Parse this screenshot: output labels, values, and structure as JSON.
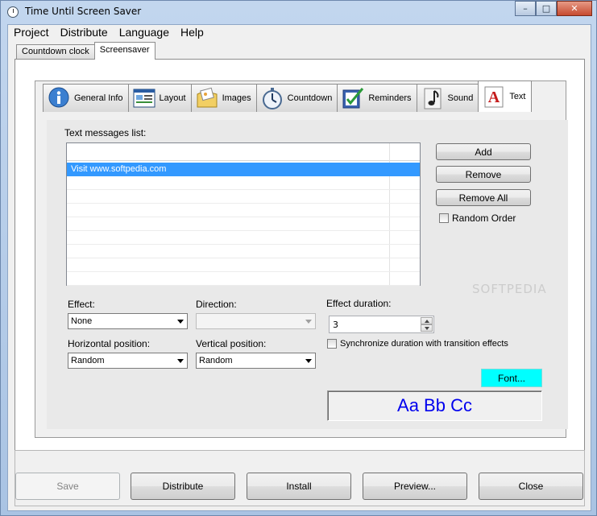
{
  "window": {
    "title": "Time Until Screen Saver",
    "minimize": "–",
    "maximize": "□",
    "close": "✕"
  },
  "menu": [
    "Project",
    "Distribute",
    "Language",
    "Help"
  ],
  "outer_tabs": {
    "items": [
      "Countdown clock",
      "Screensaver"
    ],
    "active": "Screensaver"
  },
  "inner_tabs": {
    "items": [
      {
        "label": "General Info",
        "icon": "info-icon"
      },
      {
        "label": "Layout",
        "icon": "layout-icon"
      },
      {
        "label": "Images",
        "icon": "images-icon"
      },
      {
        "label": "Countdown",
        "icon": "stopwatch-icon"
      },
      {
        "label": "Reminders",
        "icon": "checklist-icon"
      },
      {
        "label": "Sound",
        "icon": "music-note-icon"
      },
      {
        "label": "Text",
        "icon": "text-a-icon"
      }
    ],
    "active": "Text"
  },
  "text_tab": {
    "list_label": "Text messages list:",
    "messages": [
      "Visit www.softpedia.com"
    ],
    "buttons": {
      "add": "Add",
      "remove": "Remove",
      "remove_all": "Remove All"
    },
    "random_order": {
      "label": "Random Order",
      "checked": false
    },
    "effect": {
      "label": "Effect:",
      "value": "None"
    },
    "direction": {
      "label": "Direction:",
      "value": ""
    },
    "effect_duration": {
      "label": "Effect duration:",
      "value": "3"
    },
    "horizontal_position": {
      "label": "Horizontal position:",
      "value": "Random"
    },
    "vertical_position": {
      "label": "Vertical position:",
      "value": "Random"
    },
    "sync_duration": {
      "label": "Synchronize duration with transition effects",
      "checked": false
    },
    "font_button": "Font...",
    "preview_text": "Aa Bb Cc",
    "colors": {
      "font_button_bg": "#00ffff",
      "preview_text": "#0000ee",
      "selection": "#3399ff"
    }
  },
  "watermark": "SOFTPEDIA",
  "bottom_buttons": {
    "save": "Save",
    "distribute": "Distribute",
    "install": "Install",
    "preview": "Preview...",
    "close": "Close"
  }
}
